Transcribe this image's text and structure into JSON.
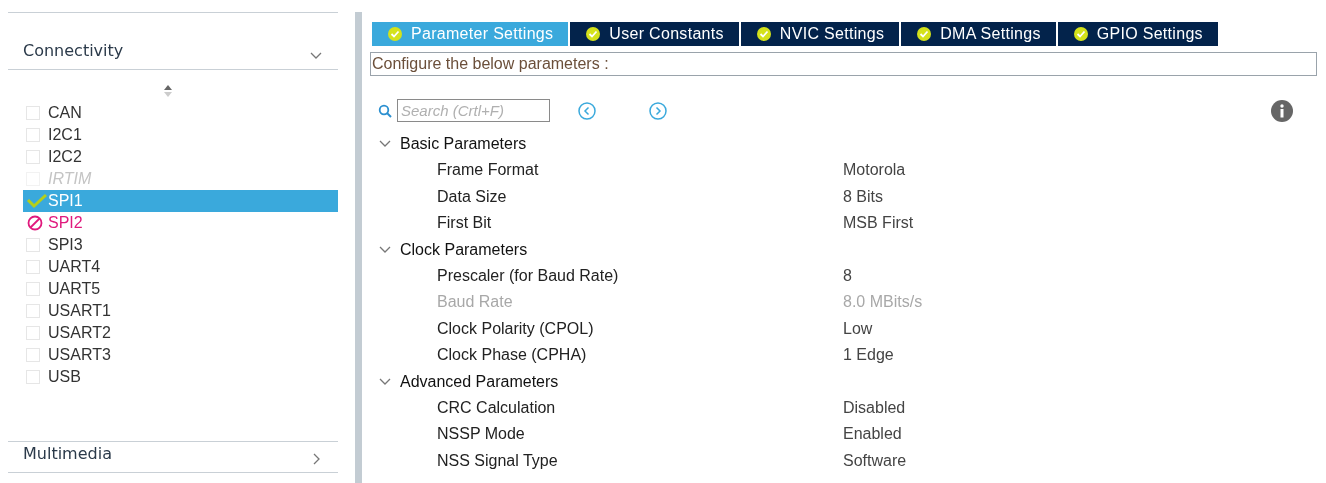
{
  "sidebar": {
    "categories": [
      {
        "label": "Connectivity",
        "expanded": true,
        "items": [
          {
            "label": "CAN",
            "kind": "none",
            "selected": false
          },
          {
            "label": "I2C1",
            "kind": "none",
            "selected": false
          },
          {
            "label": "I2C2",
            "kind": "none",
            "selected": false
          },
          {
            "label": "IRTIM",
            "kind": "disabled",
            "selected": false
          },
          {
            "label": "SPI1",
            "kind": "ok",
            "selected": true
          },
          {
            "label": "SPI2",
            "kind": "error",
            "selected": false
          },
          {
            "label": "SPI3",
            "kind": "none",
            "selected": false
          },
          {
            "label": "UART4",
            "kind": "none",
            "selected": false
          },
          {
            "label": "UART5",
            "kind": "none",
            "selected": false
          },
          {
            "label": "USART1",
            "kind": "none",
            "selected": false
          },
          {
            "label": "USART2",
            "kind": "none",
            "selected": false
          },
          {
            "label": "USART3",
            "kind": "none",
            "selected": false
          },
          {
            "label": "USB",
            "kind": "none",
            "selected": false
          }
        ]
      },
      {
        "label": "Multimedia",
        "expanded": false
      }
    ]
  },
  "tabs": [
    {
      "label": "Parameter Settings",
      "selected": true
    },
    {
      "label": "User Constants",
      "selected": false
    },
    {
      "label": "NVIC Settings",
      "selected": false
    },
    {
      "label": "DMA Settings",
      "selected": false
    },
    {
      "label": "GPIO Settings",
      "selected": false
    }
  ],
  "description": "Configure the below parameters :",
  "search": {
    "placeholder": "Search (Crtl+F)"
  },
  "groups": [
    {
      "label": "Basic Parameters",
      "expanded": true,
      "rows": [
        {
          "name": "Frame Format",
          "value": "Motorola",
          "disabled": false
        },
        {
          "name": "Data Size",
          "value": "8 Bits",
          "disabled": false
        },
        {
          "name": "First Bit",
          "value": "MSB First",
          "disabled": false
        }
      ]
    },
    {
      "label": "Clock Parameters",
      "expanded": true,
      "rows": [
        {
          "name": "Prescaler (for Baud Rate)",
          "value": "8",
          "disabled": false
        },
        {
          "name": "Baud Rate",
          "value": "8.0 MBits/s",
          "disabled": true
        },
        {
          "name": "Clock Polarity (CPOL)",
          "value": "Low",
          "disabled": false
        },
        {
          "name": "Clock Phase (CPHA)",
          "value": "1 Edge",
          "disabled": false
        }
      ]
    },
    {
      "label": "Advanced Parameters",
      "expanded": true,
      "rows": [
        {
          "name": "CRC Calculation",
          "value": "Disabled",
          "disabled": false
        },
        {
          "name": "NSSP Mode",
          "value": "Enabled",
          "disabled": false
        },
        {
          "name": "NSS Signal Type",
          "value": "Software",
          "disabled": false
        }
      ]
    }
  ]
}
